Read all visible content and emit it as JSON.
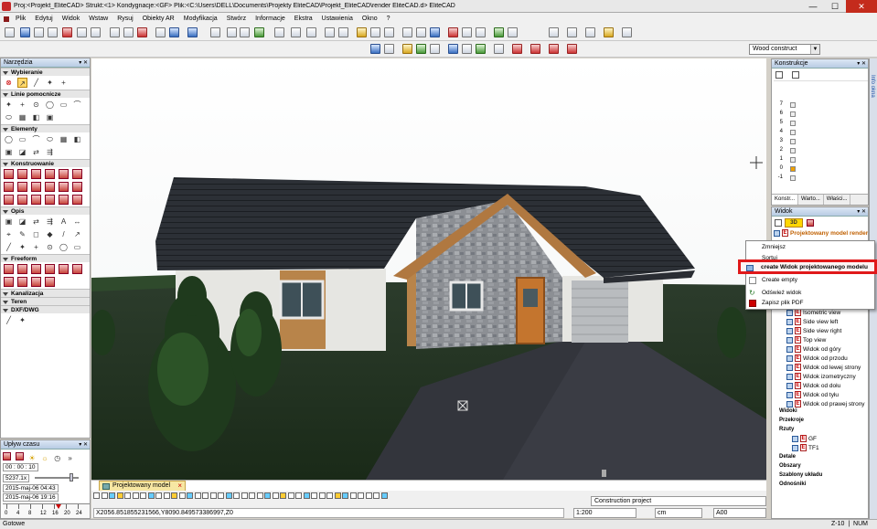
{
  "window": {
    "title": "Proj:<Projekt_EliteCAD> Strukt:<1> Kondygnacje:<GF> Plik:<C:\\Users\\DELL\\Documents\\Projekty EliteCAD\\Projekt_EliteCAD\\render EliteCAD.d> EliteCAD",
    "minimize": "—",
    "maximize": "☐",
    "close": "✕"
  },
  "menu": [
    "Plik",
    "Edytuj",
    "Widok",
    "Wstaw",
    "Rysuj",
    "Obiekty AR",
    "Modyfikacja",
    "Stwórz",
    "Informacje",
    "Ekstra",
    "Ustawienia",
    "Okno",
    "?"
  ],
  "toolbar": {
    "style_select": "Wood construct"
  },
  "left_panel": {
    "title": "Narzędzia",
    "sections": [
      "Wybieranie",
      "Linie pomocnicze",
      "Elementy",
      "Konstruowanie",
      "Opis",
      "Freeform",
      "Kanalizacja",
      "Teren",
      "DXF/DWG"
    ]
  },
  "time_panel": {
    "title": "Upływ czasu",
    "time_field": "00 : 00 : 10",
    "speed": "5237.1x",
    "date1": "2015-maj-06 04:43",
    "date2": "2015-maj-06 19:16",
    "ticks": [
      "0",
      "4",
      "8",
      "12",
      "16",
      "20",
      "24"
    ]
  },
  "viewport": {
    "tab_label": "Projektowany model",
    "tab_close": "×"
  },
  "bottom": {
    "construction": "Construction project",
    "coords": "X2056.851855231566,Y8090.849573386997,Z0",
    "scale": "1:200",
    "unit": "cm",
    "pen": "A00"
  },
  "status": {
    "left": "Gotowe",
    "zoom": "Z-10",
    "num": "NUM"
  },
  "konstrukcje": {
    "title": "Konstrukcje",
    "levels": [
      "7",
      "6",
      "5",
      "4",
      "3",
      "2",
      "1",
      "0",
      "-1"
    ],
    "tabs": [
      "Konstr...",
      "Warto...",
      "Właści..."
    ]
  },
  "side_strip": "Info okna",
  "widok": {
    "title": "Widok",
    "root_label": "Projektowany model render",
    "items": [
      "Isometric view",
      "Side view left",
      "Side view right",
      "Top view",
      "Widok od góry",
      "Widok od przodu",
      "Widok od lewej strony",
      "Widok izometryczny",
      "Widok od dołu",
      "Widok od tyłu",
      "Widok od prawej strony"
    ],
    "groups": [
      "Widoki",
      "Przekroje",
      "Rzuty"
    ],
    "rzuty": [
      "GF",
      "TF1"
    ],
    "groups2": [
      "Detale",
      "Obszary",
      "Szablony układu",
      "Odnośniki"
    ]
  },
  "context_menu": {
    "items": [
      "Zmniejsz",
      "Sortuj",
      "create Widok projektowanego modelu",
      "Create empty",
      "Odśwież widok",
      "Zapisz plik PDF"
    ]
  }
}
